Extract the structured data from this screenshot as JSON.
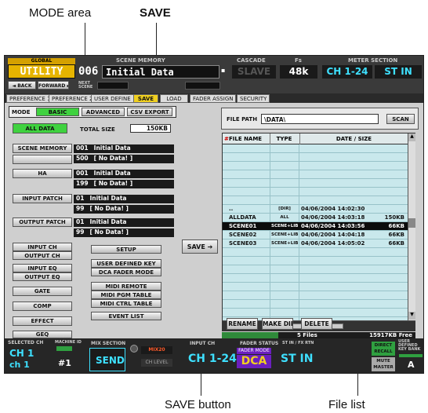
{
  "annotations": {
    "mode_area": "MODE area",
    "save": "SAVE",
    "save_button": "SAVE button",
    "file_list": "File list"
  },
  "header": {
    "global": "GLOBAL",
    "utility": "UTILITY",
    "back": "◄ BACK",
    "forward": "FORWARD ►",
    "scene_memory_label": "SCENE MEMORY",
    "scene_number": "006",
    "scene_title": "Initial Data",
    "next_scene": "NEXT SCENE",
    "cascade_label": "CASCADE",
    "cascade_value": "SLAVE",
    "fs_label": "Fs",
    "fs_value": "48k",
    "meter_label": "METER SECTION",
    "meter_ch": "CH 1-24",
    "meter_st": "ST IN"
  },
  "tabs": [
    "PREFERENCE 1",
    "PREFERENCE 2",
    "USER DEFINE",
    "SAVE",
    "LOAD",
    "FADER ASSIGN",
    "SECURITY"
  ],
  "mode": {
    "label": "MODE",
    "options": [
      "BASIC",
      "ADVANCED",
      "CSV EXPORT"
    ]
  },
  "left": {
    "all_data": "ALL DATA",
    "total_size_label": "TOTAL SIZE",
    "total_size": "150KB",
    "rows": [
      {
        "btn": "SCENE MEMORY",
        "a_num": "001",
        "a_txt": "Initial Data",
        "b_num": "500",
        "b_txt": "[ No Data! ]"
      },
      {
        "btn": "HA",
        "a_num": "001",
        "a_txt": "Initial Data",
        "b_num": "199",
        "b_txt": "[ No Data! ]"
      },
      {
        "btn": "INPUT PATCH",
        "a_num": "01",
        "a_txt": "Initial Data",
        "b_num": "99",
        "b_txt": "[ No Data! ]"
      },
      {
        "btn": "OUTPUT PATCH",
        "a_num": "01",
        "a_txt": "Initial Data",
        "b_num": "99",
        "b_txt": "[ No Data! ]"
      }
    ],
    "lib_left": [
      "INPUT CH",
      "OUTPUT CH",
      "INPUT EQ",
      "OUTPUT EQ",
      "GATE",
      "COMP",
      "EFFECT",
      "GEQ"
    ],
    "lib_right": [
      "SETUP",
      "USER DEFINED KEY",
      "DCA FADER MODE",
      "MIDI REMOTE",
      "MIDI PGM TABLE",
      "MIDI CTRL TABLE",
      "EVENT LIST"
    ]
  },
  "save_button": "SAVE ➔",
  "file": {
    "path_label": "FILE PATH",
    "path": "\\DATA\\",
    "scan": "SCAN",
    "col_name": "FILE NAME",
    "col_type": "TYPE",
    "col_date": "DATE / SIZE",
    "rows": [
      {
        "name": "..",
        "type": "[DIR]",
        "date": "04/06/2004 14:02:30",
        "size": ""
      },
      {
        "name": "ALLDATA",
        "type": "ALL",
        "date": "04/06/2004 14:03:18",
        "size": "150KB"
      },
      {
        "name": "SCENE01",
        "type": "SCENE+LIB",
        "date": "04/06/2004 14:03:56",
        "size": "66KB"
      },
      {
        "name": "SCENE02",
        "type": "SCENE+LIB",
        "date": "04/06/2004 14:04:18",
        "size": "66KB"
      },
      {
        "name": "SCENE03",
        "type": "SCENE+LIB",
        "date": "04/06/2004 14:05:02",
        "size": "66KB"
      }
    ],
    "files_count": "5 Files",
    "free": "15917KB Free",
    "rename": "RENAME",
    "make_dir": "MAKE DIR",
    "delete": "DELETE"
  },
  "bottom": {
    "selected_ch_label": "SELECTED CH",
    "ch1": "CH 1",
    "ch1_name": "ch 1",
    "machine_id_label": "MACHINE ID",
    "machine_id": "#1",
    "mix_section_label": "MIX SECTION",
    "send": "SEND",
    "mix_label": "MIX20",
    "ch_level": "CH LEVEL",
    "input_ch_label": "INPUT CH",
    "input_ch_value": "CH 1-24",
    "fader_status_label": "FADER STATUS",
    "fader_mode": "FADER MODE",
    "dca": "DCA",
    "stin_label": "ST IN / FX RTN",
    "stin_value": "ST IN",
    "direct_recall": "DIRECT RECALL",
    "mute_master": "MUTE MASTER",
    "user_def_label": "USER DEFINED KEY BANK",
    "user_bank": "A"
  }
}
